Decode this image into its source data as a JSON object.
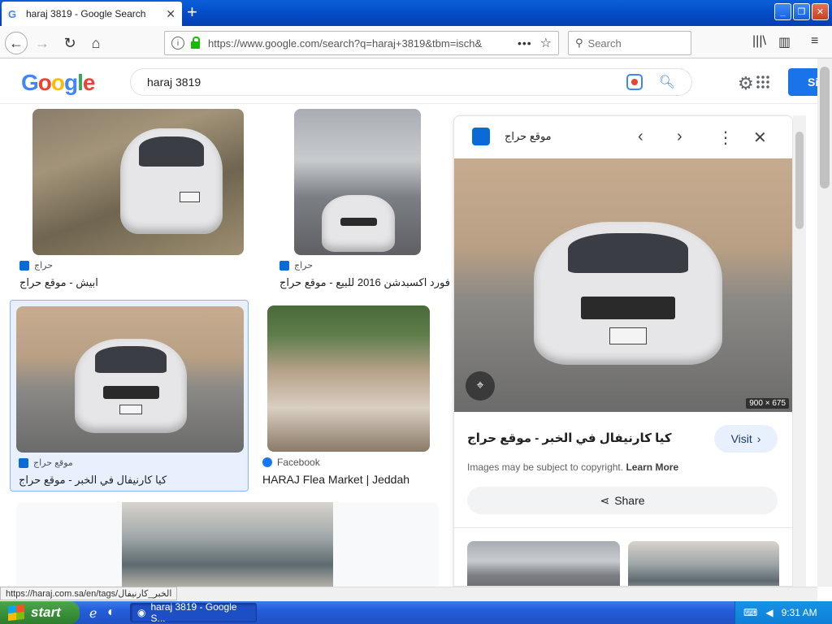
{
  "browser": {
    "tab_title": "haraj 3819 - Google Search",
    "tab_close": "✕",
    "new_tab": "+",
    "url": "https://www.google.com/search?q=haraj+3819&tbm=isch&",
    "search_placeholder": "Search"
  },
  "google": {
    "logo": "Google",
    "query": "haraj 3819",
    "signin_label": "Si"
  },
  "results": [
    {
      "source": "حراج",
      "title": "ابيش - موقع حراج"
    },
    {
      "source": "حراج",
      "title": "فورد اكسبدشن 2016 للبيع - موقع حراج"
    },
    {
      "source": "موقع حراج",
      "title": "كيا كارنيفال في الخبر - موقع حراج"
    },
    {
      "source": "Facebook",
      "title": "HARAJ Flea Market | Jeddah"
    }
  ],
  "preview": {
    "site": "موقع حراج",
    "dimensions": "900 × 675",
    "title": "كيا كارنيفال في الخبر - موقع حراج",
    "visit_label": "Visit",
    "copyright": "Images may be subject to copyright.",
    "learn_more": "Learn More",
    "share_label": "Share"
  },
  "status_url": "https://haraj.com.sa/en/tags/الخبر_كارنيفال",
  "taskbar": {
    "start_label": "start",
    "task_label": "haraj 3819 - Google S...",
    "clock": "9:31 AM"
  },
  "colors": {
    "accent": "#1a73e8",
    "taskbar": "#245ddb",
    "start": "#3a913a"
  }
}
